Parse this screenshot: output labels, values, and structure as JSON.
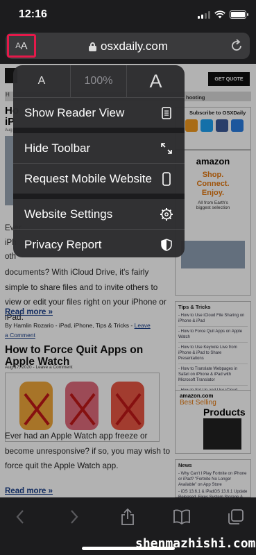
{
  "status_bar": {
    "time": "12:16"
  },
  "address_bar": {
    "aa_small": "A",
    "aa_big": "A",
    "url": "osxdaily.com"
  },
  "popover": {
    "font_small": "A",
    "zoom": "100%",
    "font_big": "A",
    "items": [
      {
        "label": "Show Reader View",
        "icon": "reader-icon"
      },
      {
        "label": "Hide Toolbar",
        "icon": "expand-arrows-icon"
      },
      {
        "label": "Request Mobile Website",
        "icon": "phone-icon"
      },
      {
        "label": "Website Settings",
        "icon": "gear-icon"
      },
      {
        "label": "Privacy Report",
        "icon": "shield-icon"
      }
    ]
  },
  "page": {
    "get_quote": "GET QUOTE",
    "partial_left_title_1": "Ho",
    "partial_left_title_2": "iP",
    "partial_aug": "Aug",
    "partial_comment": "Comment",
    "partial_right_header": "hooting",
    "partial_ever": "Ever",
    "partial_iph": "iPh",
    "partial_oth": "oth",
    "article1_body": "documents? With iCloud Drive, it's fairly simple to share files and to invite others to view or edit your files right on your iPhone or iPad.",
    "read_more": "Read more »",
    "byline_prefix": "By Hamlin Rozario - iPad, iPhone, Tips & Tricks - ",
    "byline_link": "Leave a Comment",
    "article2_title": "How to Force Quit Apps on Apple Watch",
    "article2_meta": "Aug 17, 2020 - Leave a Comment",
    "article2_body": "Ever had an Apple Watch app freeze or become unresponsive? if so, you may wish to force quit the Apple Watch app.",
    "read_more_2": "Read more »",
    "subscribe_title": "Subscribe to OSXDaily",
    "ad1_brand": "amazon",
    "ad1_text": "Shop. Connect. Enjoy.",
    "ad1_sub": "All from Earth's biggest selection",
    "tips_title": "Tips & Tricks",
    "tips": [
      "- How to Use iCloud File Sharing on iPhone & iPad",
      "- How to Force Quit Apps on Apple Watch",
      "- How to Use Keynote Live from iPhone & iPad to Share Presentations",
      "- How to Translate Webpages in Safari on iPhone & iPad with Microsoft Translator",
      "- How to Set Up and Use iCloud Email Aliases"
    ],
    "ad2_brand": "amazon.com",
    "ad2_text": "Best Selling",
    "ad2_products": "Products",
    "news_title": "News",
    "news": [
      "- Why Can't I Play Fortnite on iPhone or iPad? \"Fortnite No Longer Available\" on App Store",
      "- iOS 13.6.1 & iPadOS 13.6.1 Update Released, Fixes System Storage & Green"
    ]
  },
  "watermark": "shenmazhishi.com",
  "colors": {
    "highlight": "#e5194a",
    "link": "#1a3f8a",
    "amazon_orange": "#e47911"
  }
}
